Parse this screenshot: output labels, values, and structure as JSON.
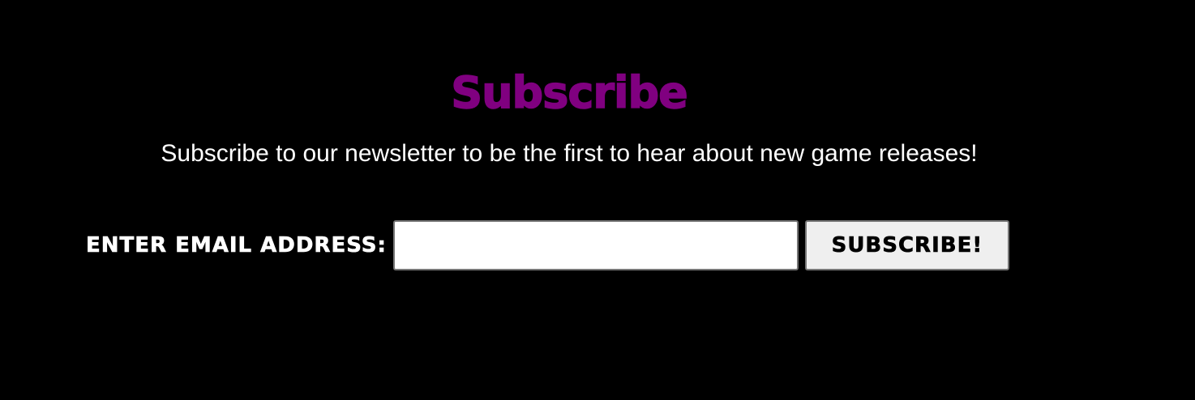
{
  "newsletter": {
    "title": "Subscribe",
    "description": "Subscribe to our newsletter to be the first to hear about new game releases!",
    "form": {
      "email_label": "ENTER EMAIL ADDRESS:",
      "email_value": "",
      "email_placeholder": "",
      "submit_label": "SUBSCRIBE!"
    }
  },
  "colors": {
    "background": "#000000",
    "title": "#800080",
    "text": "#ffffff",
    "button_bg": "#efefef"
  }
}
